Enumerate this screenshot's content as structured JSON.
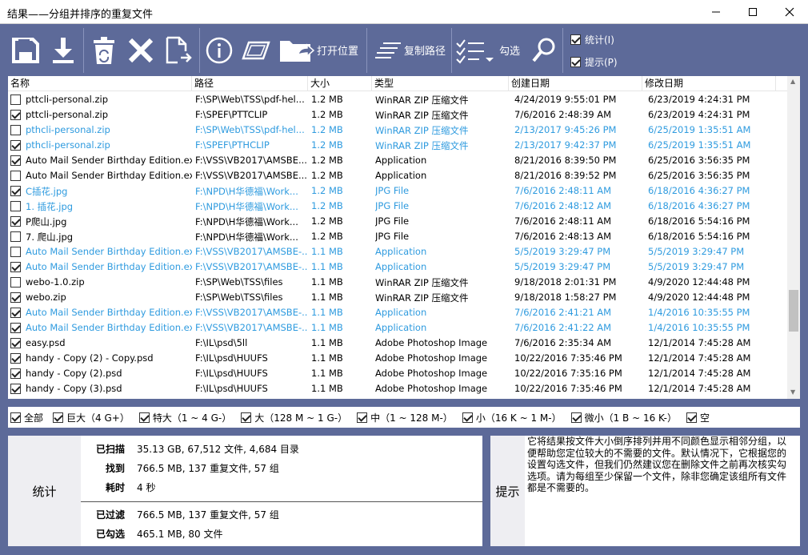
{
  "window": {
    "title": "结果——分组并排序的重复文件"
  },
  "toolbar": {
    "items": [
      {
        "icon": "save-icon"
      },
      {
        "icon": "download-icon"
      },
      {
        "icon": "recycle-bin-icon"
      },
      {
        "icon": "delete-x-icon"
      },
      {
        "icon": "move-file-icon"
      },
      {
        "icon": "info-icon"
      },
      {
        "icon": "preview-icon"
      }
    ],
    "open_location_label": "打开位置",
    "copy_path_label": "复制路径",
    "select_label": "勾选",
    "search_icon": "search-icon",
    "stats_check_label": "统计(I)",
    "hint_check_label": "提示(P)"
  },
  "columns": [
    "名称",
    "路径",
    "大小",
    "类型",
    "创建日期",
    "修改日期"
  ],
  "rows": [
    {
      "checked": false,
      "blue": false,
      "name": "pttcli-personal.zip",
      "path": "F:\\SP\\Web\\TSS\\pdf-hel...",
      "size": "1.2 MB",
      "type": "WinRAR ZIP 压缩文件",
      "created": "4/24/2019 9:55:01 PM",
      "modified": "6/23/2019 4:24:31 PM"
    },
    {
      "checked": true,
      "blue": false,
      "name": "pttcli-personal.zip",
      "path": "F:\\SPEF\\PTTCLIP",
      "size": "1.2 MB",
      "type": "WinRAR ZIP 压缩文件",
      "created": "7/6/2016 2:48:39 AM",
      "modified": "6/23/2019 4:24:31 PM"
    },
    {
      "checked": false,
      "blue": true,
      "name": "pthcli-personal.zip",
      "path": "F:\\SP\\Web\\TSS\\pdf-hel...",
      "size": "1.2 MB",
      "type": "WinRAR ZIP 压缩文件",
      "created": "2/13/2017 9:45:26 PM",
      "modified": "6/25/2019 1:35:51 AM"
    },
    {
      "checked": true,
      "blue": true,
      "name": "pthcli-personal.zip",
      "path": "F:\\SPEF\\PTHCLIP",
      "size": "1.2 MB",
      "type": "WinRAR ZIP 压缩文件",
      "created": "2/13/2017 9:42:37 PM",
      "modified": "6/25/2019 1:35:51 AM"
    },
    {
      "checked": true,
      "blue": false,
      "name": "Auto Mail Sender Birthday Edition.exe",
      "path": "F:\\VSS\\VB2017\\AMSBE...",
      "size": "1.2 MB",
      "type": "Application",
      "created": "8/21/2016 8:39:50 PM",
      "modified": "6/25/2016 3:56:35 PM"
    },
    {
      "checked": false,
      "blue": false,
      "name": "Auto Mail Sender Birthday Edition.exe",
      "path": "F:\\VSS\\VB2017\\AMSBE...",
      "size": "1.2 MB",
      "type": "Application",
      "created": "8/21/2016 8:39:52 PM",
      "modified": "6/25/2016 3:56:35 PM"
    },
    {
      "checked": true,
      "blue": true,
      "name": "C插花.jpg",
      "path": "F:\\NPD\\H华德福\\Work...",
      "size": "1.2 MB",
      "type": "JPG File",
      "created": "7/6/2016 2:48:11 AM",
      "modified": "6/18/2016 4:36:27 PM"
    },
    {
      "checked": false,
      "blue": true,
      "name": "1. 插花.jpg",
      "path": "F:\\NPD\\H华德福\\Work...",
      "size": "1.2 MB",
      "type": "JPG File",
      "created": "7/6/2016 2:48:12 AM",
      "modified": "6/18/2016 4:36:27 PM"
    },
    {
      "checked": true,
      "blue": false,
      "name": "P爬山.jpg",
      "path": "F:\\NPD\\H华德福\\Work...",
      "size": "1.2 MB",
      "type": "JPG File",
      "created": "7/6/2016 2:48:11 AM",
      "modified": "6/18/2016 5:54:16 PM"
    },
    {
      "checked": false,
      "blue": false,
      "name": "7. 爬山.jpg",
      "path": "F:\\NPD\\H华德福\\Work...",
      "size": "1.2 MB",
      "type": "JPG File",
      "created": "7/6/2016 2:48:13 AM",
      "modified": "6/18/2016 5:54:16 PM"
    },
    {
      "checked": false,
      "blue": true,
      "name": "Auto Mail Sender Birthday Edition.exe",
      "path": "F:\\VSS\\VB2017\\AMSBE-...",
      "size": "1.1 MB",
      "type": "Application",
      "created": "5/5/2019 3:29:47 PM",
      "modified": "5/5/2019 3:29:47 PM"
    },
    {
      "checked": true,
      "blue": true,
      "name": "Auto Mail Sender Birthday Edition.exe",
      "path": "F:\\VSS\\VB2017\\AMSBE-...",
      "size": "1.1 MB",
      "type": "Application",
      "created": "5/5/2019 3:29:47 PM",
      "modified": "5/5/2019 3:29:47 PM"
    },
    {
      "checked": false,
      "blue": false,
      "name": "webo-1.0.zip",
      "path": "F:\\SP\\Web\\TSS\\files",
      "size": "1.1 MB",
      "type": "WinRAR ZIP 压缩文件",
      "created": "9/18/2018 2:01:31 PM",
      "modified": "4/9/2020 12:44:48 PM"
    },
    {
      "checked": true,
      "blue": false,
      "name": "webo.zip",
      "path": "F:\\SP\\Web\\TSS\\files",
      "size": "1.1 MB",
      "type": "WinRAR ZIP 压缩文件",
      "created": "9/18/2018 1:58:27 PM",
      "modified": "4/9/2020 12:44:48 PM"
    },
    {
      "checked": true,
      "blue": true,
      "name": "Auto Mail Sender Birthday Edition.exe",
      "path": "F:\\VSS\\VB2017\\AMSBE-...",
      "size": "1.1 MB",
      "type": "Application",
      "created": "7/6/2016 2:41:21 AM",
      "modified": "1/4/2016 10:35:55 PM"
    },
    {
      "checked": true,
      "blue": true,
      "name": "Auto Mail Sender Birthday Edition.exe",
      "path": "F:\\VSS\\VB2017\\AMSBE-...",
      "size": "1.1 MB",
      "type": "Application",
      "created": "7/6/2016 2:41:22 AM",
      "modified": "1/4/2016 10:35:55 PM"
    },
    {
      "checked": true,
      "blue": false,
      "name": "easy.psd",
      "path": "F:\\IL\\psd\\5ll",
      "size": "1.1 MB",
      "type": "Adobe Photoshop Image",
      "created": "7/6/2016 2:35:34 AM",
      "modified": "12/1/2014 7:45:28 AM"
    },
    {
      "checked": true,
      "blue": false,
      "name": "handy - Copy (2) - Copy.psd",
      "path": "F:\\IL\\psd\\HUUFS",
      "size": "1.1 MB",
      "type": "Adobe Photoshop Image",
      "created": "10/22/2016 7:35:46 PM",
      "modified": "12/1/2014 7:45:28 AM"
    },
    {
      "checked": true,
      "blue": false,
      "name": "handy - Copy (2).psd",
      "path": "F:\\IL\\psd\\HUUFS",
      "size": "1.1 MB",
      "type": "Adobe Photoshop Image",
      "created": "10/22/2016 7:35:16 PM",
      "modified": "12/1/2014 7:45:28 AM"
    },
    {
      "checked": true,
      "blue": false,
      "name": "handy - Copy (3).psd",
      "path": "F:\\IL\\psd\\HUUFS",
      "size": "1.1 MB",
      "type": "Adobe Photoshop Image",
      "created": "10/22/2016 7:35:46 PM",
      "modified": "12/1/2014 7:45:28 AM"
    }
  ],
  "filters": [
    {
      "label": "全部",
      "checked": true
    },
    {
      "label": "巨大（4 G+）",
      "checked": true
    },
    {
      "label": "特大（1 ~ 4 G-）",
      "checked": true
    },
    {
      "label": "大（128 M ~ 1 G-）",
      "checked": true
    },
    {
      "label": "中（1 ~ 128 M-）",
      "checked": true
    },
    {
      "label": "小（16 K ~ 1 M-）",
      "checked": true
    },
    {
      "label": "微小（1 B ~ 16 K-）",
      "checked": true
    },
    {
      "label": "空",
      "checked": true
    }
  ],
  "stats": {
    "title": "统计",
    "items": [
      {
        "key": "已扫描",
        "value": "35.13 GB, 67,512 文件, 4,684 目录"
      },
      {
        "key": "找到",
        "value": "766.5 MB, 137 重复文件, 57 组"
      },
      {
        "key": "耗时",
        "value": "4 秒"
      },
      {
        "key": "已过滤",
        "value": "766.5 MB, 137 重复文件, 57 组"
      },
      {
        "key": "已勾选",
        "value": "465.1 MB, 80 文件"
      }
    ]
  },
  "tip": {
    "title": "提示",
    "text": "它将结果按文件大小倒序排列并用不同颜色显示相邻分组，以便帮助您定位较大的不需要的文件。默认情况下，它根据您的设置勾选文件，但我们仍然建议您在删除文件之前再次核实勾选项。请为每组至少保留一个文件，除非您确定该组所有文件都是不需要的。"
  }
}
